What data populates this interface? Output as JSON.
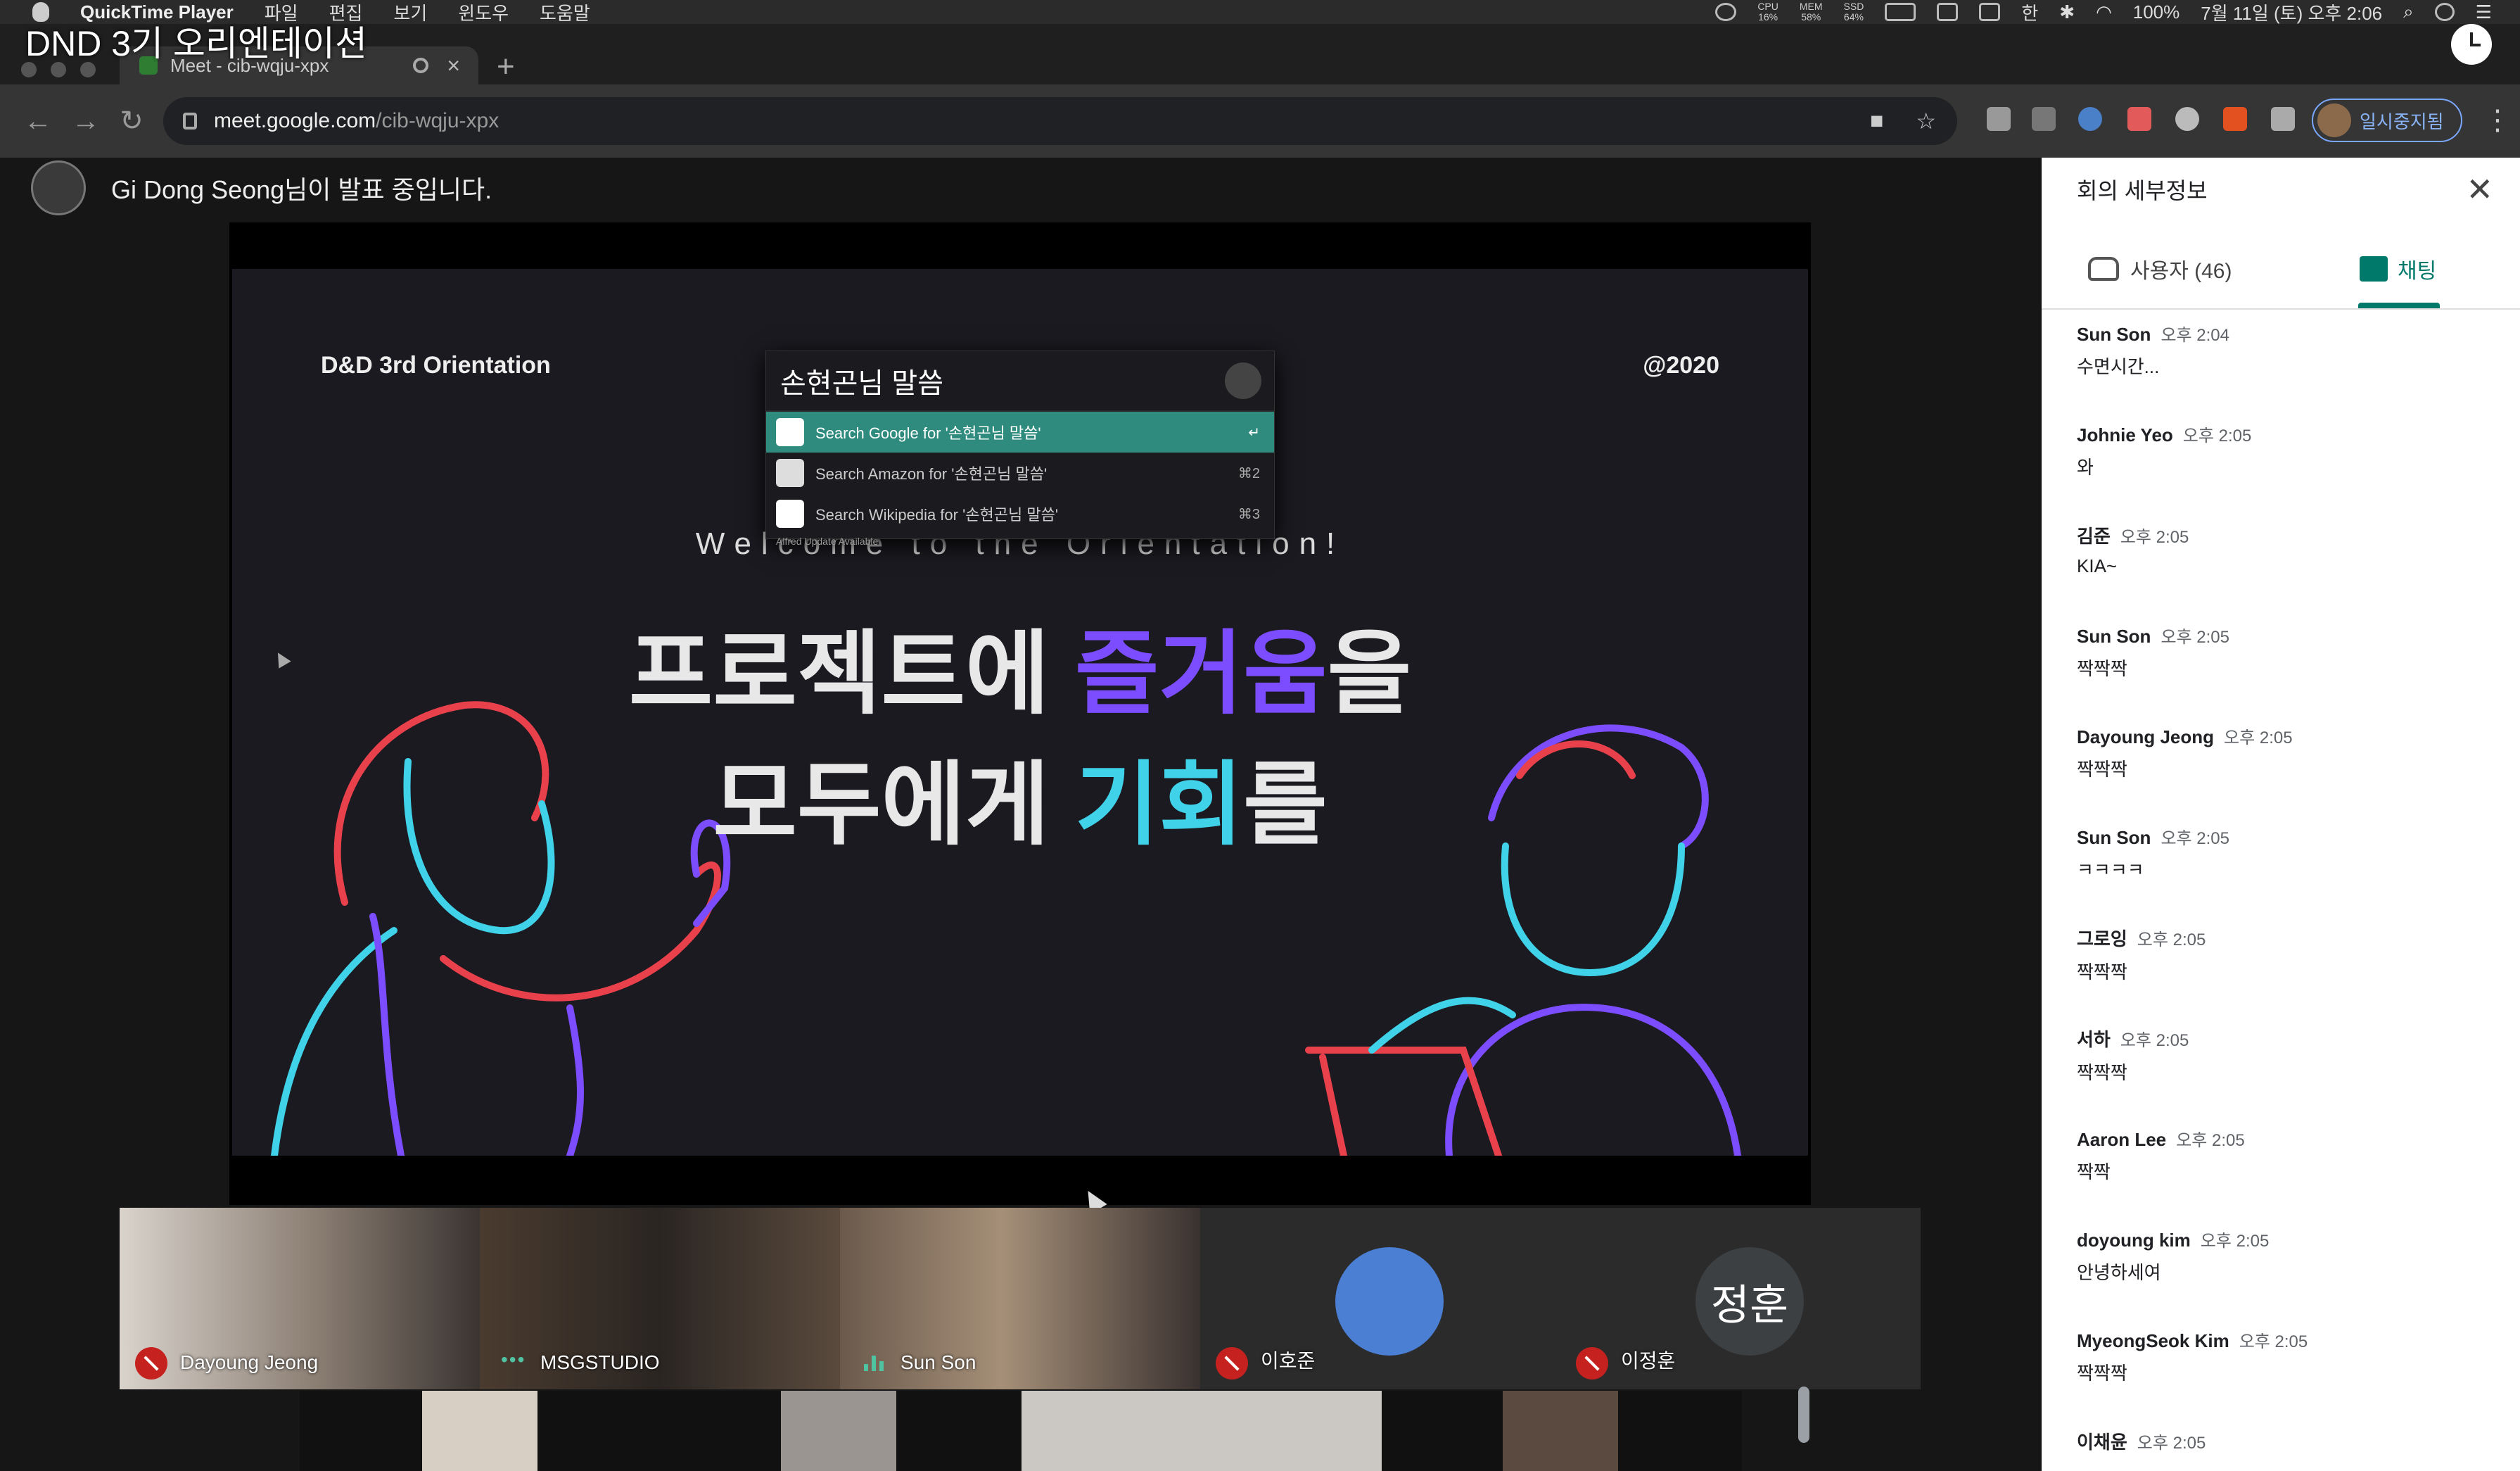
{
  "menubar": {
    "app": "QuickTime Player",
    "items": [
      "파일",
      "편집",
      "보기",
      "윈도우",
      "도움말"
    ],
    "cpu_label": "CPU",
    "cpu": "16%",
    "mem_label": "MEM",
    "mem": "58%",
    "ssd_label": "SSD",
    "ssd": "64%",
    "input_source": "한",
    "battery": "100%",
    "datetime": "7월 11일 (토) 오후 2:06"
  },
  "overlay_title": "DND 3기 오리엔테이션",
  "browser": {
    "tab_title": "Meet - cib-wqju-xpx",
    "url_host": "meet.google.com",
    "url_path": "/cib-wqju-xpx",
    "profile_label": "일시중지됨"
  },
  "presenter": "Gi Dong Seong님이 발표 중입니다.",
  "slide": {
    "header_left": "D&D 3rd Orientation",
    "header_right": "@2020",
    "welcome": "Welcome to the Orientation!",
    "line1_a": "프로젝트에 ",
    "line1_b": "즐거움",
    "line1_c": "을",
    "line2_a": "모두에게 ",
    "line2_b": "기회",
    "line2_c": "를",
    "accent_purple": "#7c4dff",
    "accent_cyan": "#3fd2e8",
    "accent_red": "#e8414c"
  },
  "alfred": {
    "query": "손현곤님 말씀",
    "rows": [
      {
        "label": "Search Google for '손현곤님 말씀'",
        "shortcut": "↵",
        "icon": "google-icon"
      },
      {
        "label": "Search Amazon for '손현곤님 말씀'",
        "shortcut": "⌘2",
        "icon": "amazon-icon"
      },
      {
        "label": "Search Wikipedia for '손현곤님 말씀'",
        "shortcut": "⌘3",
        "icon": "wikipedia-icon"
      }
    ],
    "update_note": "Alfred Update Available"
  },
  "participants": [
    {
      "name": "Dayoung Jeong",
      "status": "muted"
    },
    {
      "name": "MSGSTUDIO",
      "status": "connecting"
    },
    {
      "name": "Sun Son",
      "status": "speaking"
    },
    {
      "name": "이호준",
      "status": "muted"
    },
    {
      "name": "이정훈",
      "status": "muted",
      "initials": "정훈"
    }
  ],
  "sidebar": {
    "title": "회의 세부정보",
    "tab_people": "사용자 (46)",
    "tab_chat": "채팅",
    "accent": "#00796b",
    "messages": [
      {
        "sender": "Sun Son",
        "time": "오후 2:04",
        "text": "수면시간..."
      },
      {
        "sender": "Johnie Yeo",
        "time": "오후 2:05",
        "text": "와"
      },
      {
        "sender": "김준",
        "time": "오후 2:05",
        "text": "KIA~"
      },
      {
        "sender": "Sun Son",
        "time": "오후 2:05",
        "text": "짝짝짝"
      },
      {
        "sender": "Dayoung Jeong",
        "time": "오후 2:05",
        "text": "짝짝짝"
      },
      {
        "sender": "Sun Son",
        "time": "오후 2:05",
        "text": "ㅋㅋㅋㅋ"
      },
      {
        "sender": "그로잉",
        "time": "오후 2:05",
        "text": "짝짝짝"
      },
      {
        "sender": "서하",
        "time": "오후 2:05",
        "text": "짝짝짝"
      },
      {
        "sender": "Aaron Lee",
        "time": "오후 2:05",
        "text": "짝짝"
      },
      {
        "sender": "doyoung kim",
        "time": "오후 2:05",
        "text": "안녕하세여"
      },
      {
        "sender": "MyeongSeok Kim",
        "time": "오후 2:05",
        "text": "짝짝짝"
      },
      {
        "sender": "이채윤",
        "time": "오후 2:05",
        "text": ""
      }
    ]
  }
}
